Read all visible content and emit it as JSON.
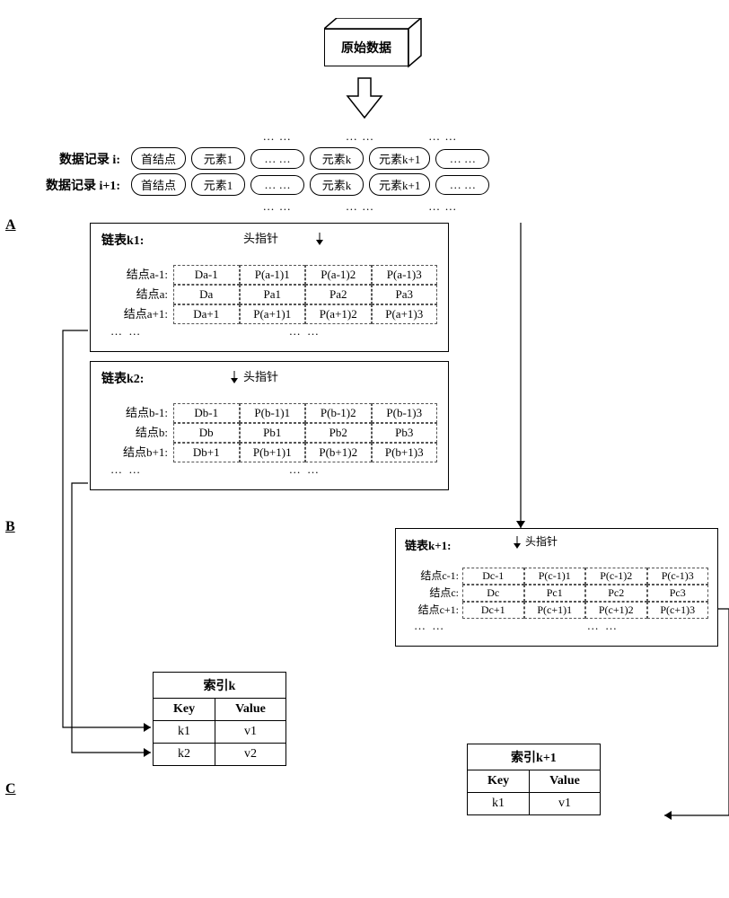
{
  "top_label": "原始数据",
  "records": {
    "ell": "… …",
    "ell_mid": "… …",
    "row_i_label": "数据记录 i:",
    "row_ip1_label": "数据记录 i+1:",
    "pills": {
      "head": "首结点",
      "e1": "元素1",
      "dots": "… …",
      "ek": "元素k",
      "ekp1": "元素k+1"
    }
  },
  "sections": {
    "A": "A",
    "B": "B",
    "C": "C"
  },
  "head_pointer": "头指针",
  "panel_k1": {
    "title": "链表k1:",
    "rows": [
      {
        "lbl": "结点a-1:",
        "d": "Da-1",
        "p1": "P(a-1)1",
        "p2": "P(a-1)2",
        "p3": "P(a-1)3"
      },
      {
        "lbl": "结点a:",
        "d": "Da",
        "p1": "Pa1",
        "p2": "Pa2",
        "p3": "Pa3"
      },
      {
        "lbl": "结点a+1:",
        "d": "Da+1",
        "p1": "P(a+1)1",
        "p2": "P(a+1)2",
        "p3": "P(a+1)3"
      }
    ]
  },
  "panel_k2": {
    "title": "链表k2:",
    "rows": [
      {
        "lbl": "结点b-1:",
        "d": "Db-1",
        "p1": "P(b-1)1",
        "p2": "P(b-1)2",
        "p3": "P(b-1)3"
      },
      {
        "lbl": "结点b:",
        "d": "Db",
        "p1": "Pb1",
        "p2": "Pb2",
        "p3": "Pb3"
      },
      {
        "lbl": "结点b+1:",
        "d": "Db+1",
        "p1": "P(b+1)1",
        "p2": "P(b+1)2",
        "p3": "P(b+1)3"
      }
    ]
  },
  "panel_kp1": {
    "title": "链表k+1:",
    "rows": [
      {
        "lbl": "结点c-1:",
        "d": "Dc-1",
        "p1": "P(c-1)1",
        "p2": "P(c-1)2",
        "p3": "P(c-1)3"
      },
      {
        "lbl": "结点c:",
        "d": "Dc",
        "p1": "Pc1",
        "p2": "Pc2",
        "p3": "Pc3"
      },
      {
        "lbl": "结点c+1:",
        "d": "Dc+1",
        "p1": "P(c+1)1",
        "p2": "P(c+1)2",
        "p3": "P(c+1)3"
      }
    ]
  },
  "index_k": {
    "title": "索引k",
    "key_h": "Key",
    "val_h": "Value",
    "rows": [
      {
        "k": "k1",
        "v": "v1"
      },
      {
        "k": "k2",
        "v": "v2"
      }
    ]
  },
  "index_kp1": {
    "title": "索引k+1",
    "key_h": "Key",
    "val_h": "Value",
    "rows": [
      {
        "k": "k1",
        "v": "v1"
      }
    ]
  },
  "ell_text": "… …"
}
